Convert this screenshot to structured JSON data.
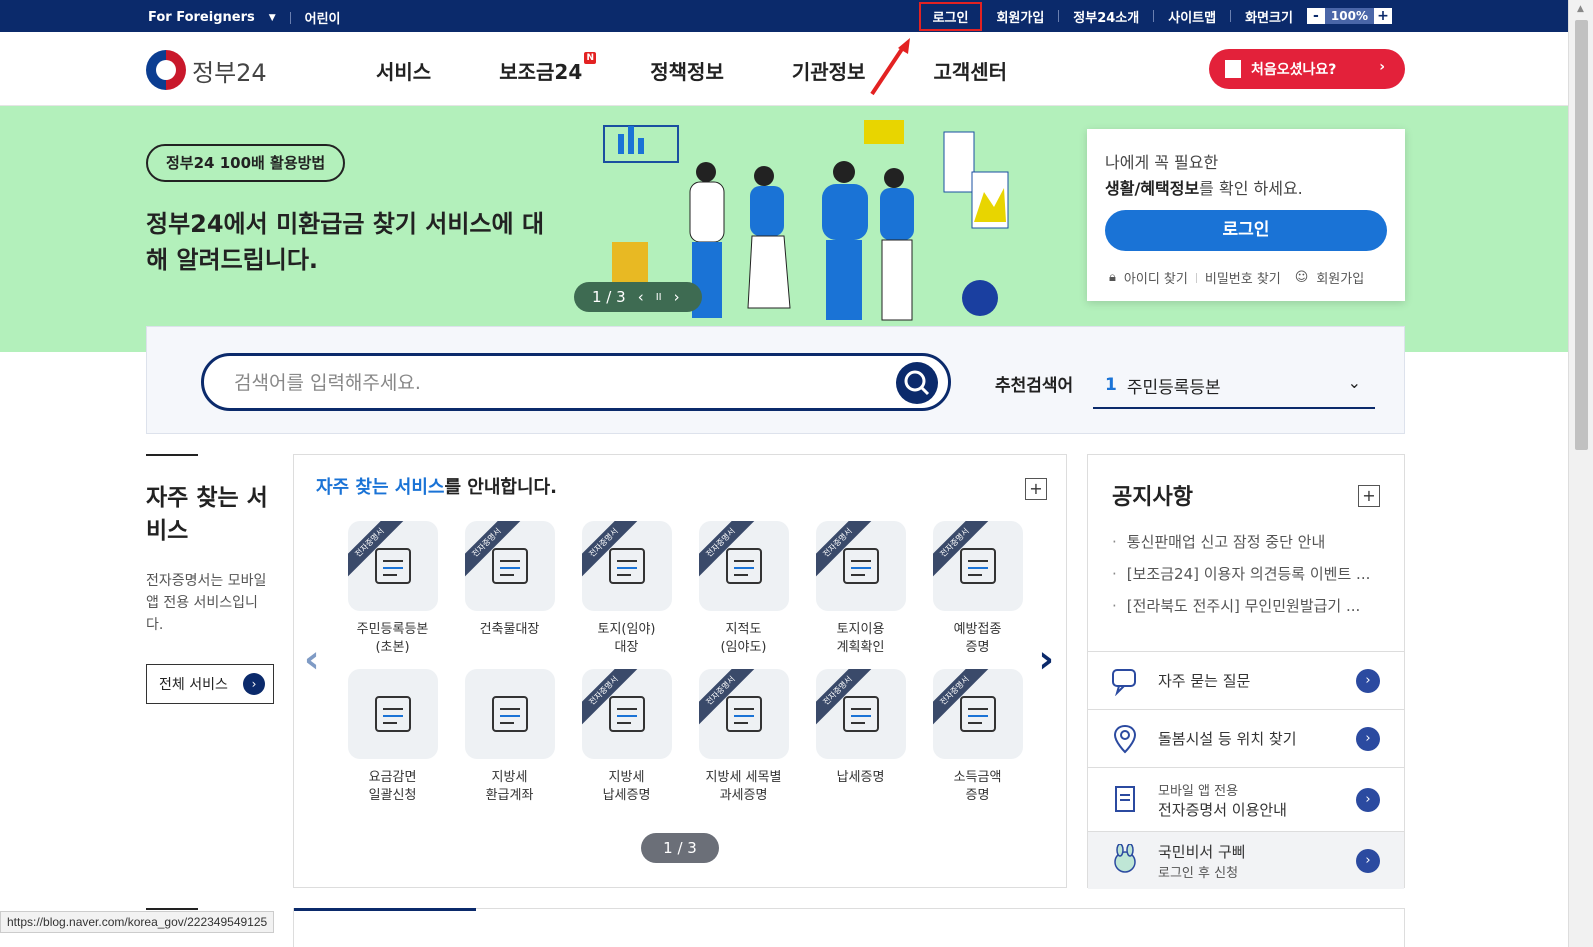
{
  "topbar": {
    "foreigners": "For Foreigners",
    "kids": "어린이",
    "login": "로그인",
    "signup": "회원가입",
    "about": "정부24소개",
    "sitemap": "사이트맵",
    "screen_size": "화면크기",
    "zoom_minus": "-",
    "zoom_value": "100%",
    "zoom_plus": "+"
  },
  "header": {
    "logo": "정부24",
    "nav": [
      "서비스",
      "보조금24",
      "정책정보",
      "기관정보",
      "고객센터"
    ],
    "new_badge": "N",
    "first_visit": "처음오셨나요?"
  },
  "hero": {
    "pill": "정부24 100배 활용방법",
    "headline": "정부24에서 미환급금 찾기 서비스에 대해 알려드립니다.",
    "counter": "1 / 3",
    "prev": "‹",
    "pause": "II",
    "next": "›"
  },
  "loginbox": {
    "line1": "나에게 꼭 필요한",
    "line2_bold": "생활/혜택정보",
    "line2_rest": "를 확인 하세요.",
    "login_button": "로그인",
    "find_id": "아이디 찾기",
    "find_pw": "비밀번호 찾기",
    "signup": "회원가입"
  },
  "search": {
    "placeholder": "검색어를 입력해주세요.",
    "recommend_label": "추천검색어",
    "recommend_num": "1",
    "recommend_value": "주민등록등본"
  },
  "frequent": {
    "title": "자주 찾는 서비스",
    "desc": "전자증명서는 모바일 앱 전용 서비스입니다.",
    "all_button": "전체 서비스",
    "panel_head_hl": "자주 찾는 서비스",
    "panel_head_rest": "를 안내합니다.",
    "ribbon": "전자증명서",
    "items": [
      {
        "label": "주민등록등본\n(초본)",
        "ribbon": true
      },
      {
        "label": "건축물대장",
        "ribbon": true
      },
      {
        "label": "토지(임야)\n대장",
        "ribbon": true
      },
      {
        "label": "지적도\n(임야도)",
        "ribbon": true
      },
      {
        "label": "토지이용\n계획확인",
        "ribbon": true
      },
      {
        "label": "예방접종\n증명",
        "ribbon": true
      },
      {
        "label": "요금감면\n일괄신청",
        "ribbon": false
      },
      {
        "label": "지방세\n환급계좌",
        "ribbon": false
      },
      {
        "label": "지방세\n납세증명",
        "ribbon": true
      },
      {
        "label": "지방세 세목별\n과세증명",
        "ribbon": true
      },
      {
        "label": "납세증명",
        "ribbon": true
      },
      {
        "label": "소득금액\n증명",
        "ribbon": true
      }
    ],
    "pager": "1 / 3"
  },
  "notice": {
    "title": "공지사항",
    "items": [
      "통신판매업 신고 잠정 중단 안내",
      "[보조금24] 이용자 의견등록 이벤트 ...",
      "[전라북도 전주시] 무인민원발급기 ..."
    ],
    "faq": "자주 묻는 질문",
    "care": "돌봄시설 등 위치 찾기",
    "mobile_sub": "모바일 앱 전용",
    "mobile_main": "전자증명서 이용안내",
    "gubbi_main": "국민비서 구삐",
    "gubbi_sub": "로그인 후 신청"
  },
  "statusbar": {
    "url": "https://blog.naver.com/korea_gov/222349549125"
  },
  "colors": {
    "navy": "#0b2a6b",
    "hero_bg": "#b3f0bb",
    "accent_red": "#e3213a",
    "login_blue": "#1a73d6"
  }
}
